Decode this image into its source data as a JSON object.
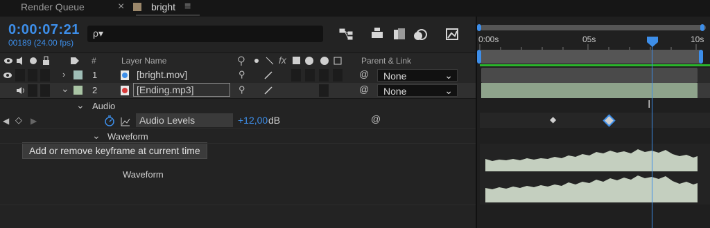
{
  "tabs": {
    "render_queue": "Render Queue",
    "close_glyph": "×",
    "comp_name": "bright",
    "menu_glyph": "≡"
  },
  "comp": {
    "timecode": "0:00:07:21",
    "frames": "00189 (24.00 fps)",
    "search_placeholder": "ρ▾"
  },
  "header": {
    "hash": "#",
    "layer_name": "Layer Name",
    "fx": "fx",
    "parent_link": "Parent & Link"
  },
  "layers": [
    {
      "index": "1",
      "name": "[bright.mov]",
      "parent": "None",
      "label_color": "#9fbdb6"
    },
    {
      "index": "2",
      "name": "[Ending.mp3]",
      "parent": "None",
      "label_color": "#a9c4a4"
    }
  ],
  "audio_group": {
    "label": "Audio",
    "property": "Audio Levels",
    "value": "+12,00",
    "unit": "dB"
  },
  "waveform_group": {
    "label": "Waveform",
    "sublabel": "Waveform"
  },
  "tooltip": "Add or remove keyframe at current time",
  "timeline": {
    "ticks": [
      "0:00s",
      "05s",
      "10s"
    ],
    "playhead_seconds": 7.875,
    "colors": {
      "accent": "#3d8ee9",
      "green": "#2bb52b",
      "waveform": "#c4cfbf"
    }
  }
}
